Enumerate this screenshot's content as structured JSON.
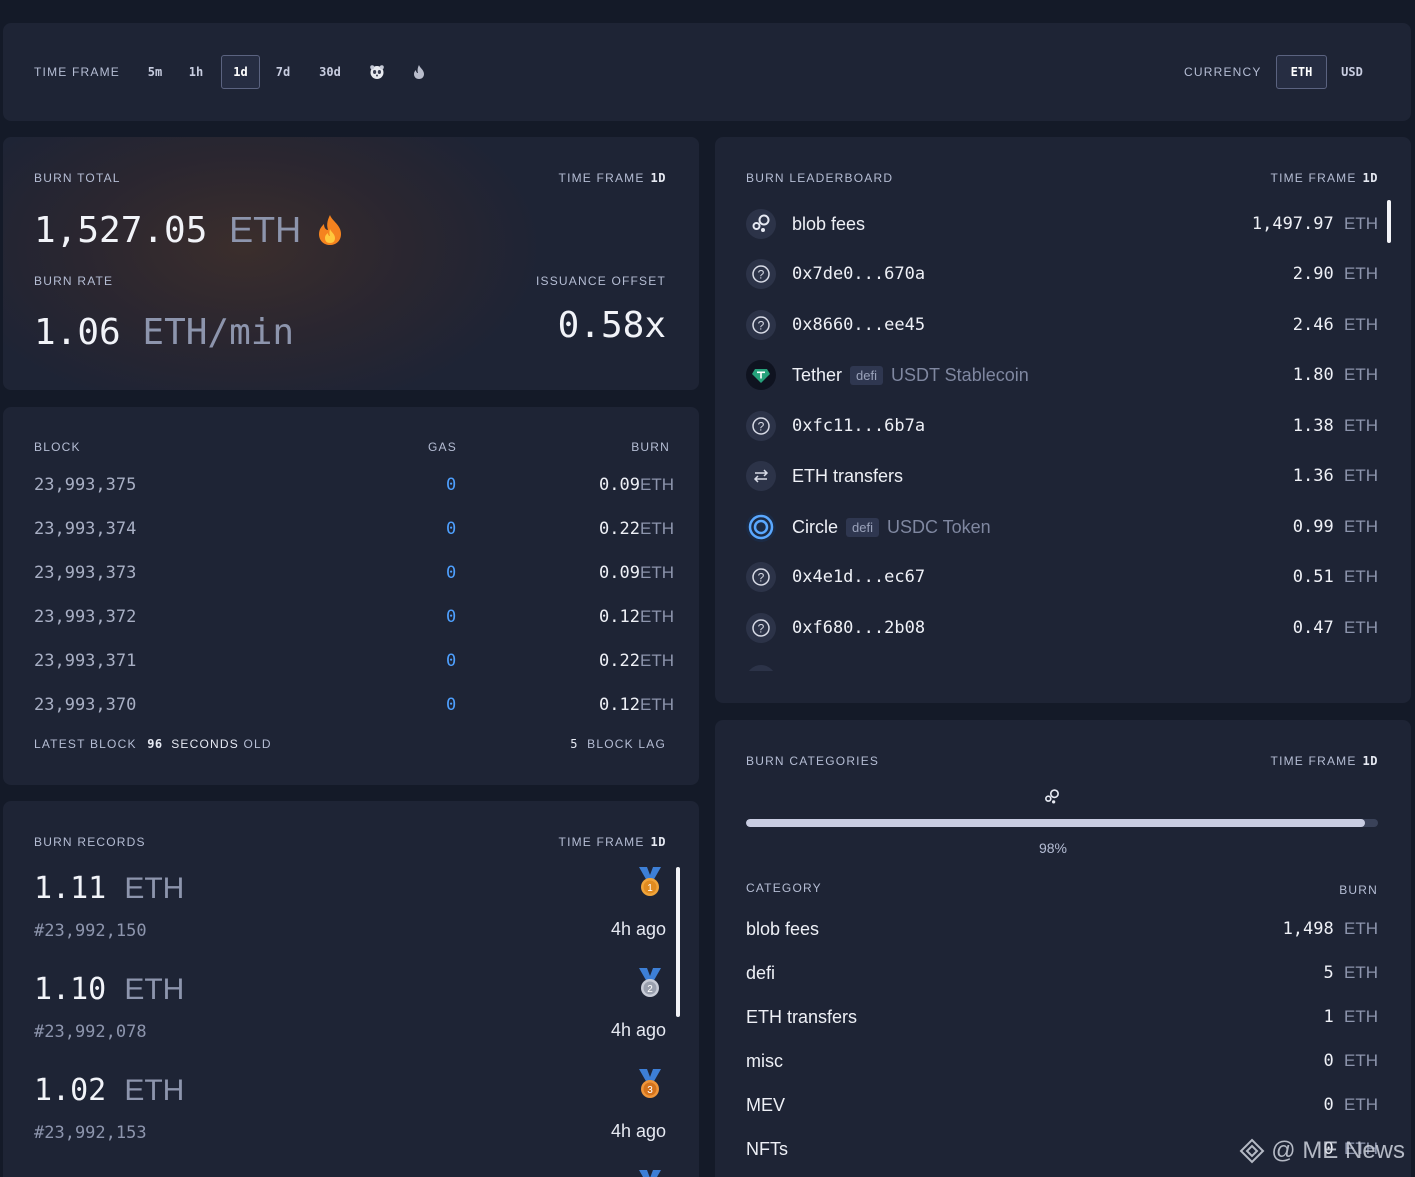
{
  "topbar": {
    "time_frame_label": "TIME FRAME",
    "time_frames": [
      "5m",
      "1h",
      "1d",
      "7d",
      "30d"
    ],
    "active_time_frame": "1d",
    "extra_icons": [
      "panda-icon",
      "fire-icon"
    ],
    "currency_label": "CURRENCY",
    "currencies": [
      "ETH",
      "USD"
    ],
    "active_currency": "ETH"
  },
  "burn_total": {
    "label": "BURN TOTAL",
    "tf_label": "TIME FRAME",
    "tf_value": "1d",
    "value": "1,527.05",
    "unit": "ETH",
    "rate_label": "BURN RATE",
    "rate_value": "1.06",
    "rate_unit": "ETH/min",
    "offset_label": "ISSUANCE OFFSET",
    "offset_value": "0.58x"
  },
  "blocks": {
    "headers": {
      "block": "BLOCK",
      "gas": "GAS",
      "burn": "BURN"
    },
    "rows": [
      {
        "number": "23,993,375",
        "gas": "0",
        "burn": "0.09",
        "unit": "ETH"
      },
      {
        "number": "23,993,374",
        "gas": "0",
        "burn": "0.22",
        "unit": "ETH"
      },
      {
        "number": "23,993,373",
        "gas": "0",
        "burn": "0.09",
        "unit": "ETH"
      },
      {
        "number": "23,993,372",
        "gas": "0",
        "burn": "0.12",
        "unit": "ETH"
      },
      {
        "number": "23,993,371",
        "gas": "0",
        "burn": "0.22",
        "unit": "ETH"
      },
      {
        "number": "23,993,370",
        "gas": "0",
        "burn": "0.12",
        "unit": "ETH"
      }
    ],
    "footer": {
      "latest_prefix": "LATEST BLOCK",
      "latest_value": "96",
      "latest_unit": "SECONDS",
      "latest_suffix": "OLD",
      "lag_value": "5",
      "lag_label": "BLOCK LAG"
    }
  },
  "records": {
    "label": "BURN RECORDS",
    "tf_label": "TIME FRAME",
    "tf_value": "1d",
    "items": [
      {
        "value": "1.11",
        "unit": "ETH",
        "block": "#23,992,150",
        "ago": "4h ago",
        "rank": "1",
        "color": "#f0a43a"
      },
      {
        "value": "1.10",
        "unit": "ETH",
        "block": "#23,992,078",
        "ago": "4h ago",
        "rank": "2",
        "color": "#b8bcc8"
      },
      {
        "value": "1.02",
        "unit": "ETH",
        "block": "#23,992,153",
        "ago": "4h ago",
        "rank": "3",
        "color": "#e8893a"
      }
    ]
  },
  "leaderboard": {
    "label": "BURN LEADERBOARD",
    "tf_label": "TIME FRAME",
    "tf_value": "1d",
    "rows": [
      {
        "icon": "blob-icon",
        "name": "blob fees",
        "mono": false,
        "tag": "",
        "sub": "",
        "amount": "1,497.97",
        "unit": "ETH"
      },
      {
        "icon": "question-icon",
        "name": "0x7de0...670a",
        "mono": true,
        "tag": "",
        "sub": "",
        "amount": "2.90",
        "unit": "ETH"
      },
      {
        "icon": "question-icon",
        "name": "0x8660...ee45",
        "mono": true,
        "tag": "",
        "sub": "",
        "amount": "2.46",
        "unit": "ETH"
      },
      {
        "icon": "tether-icon",
        "name": "Tether",
        "mono": false,
        "tag": "defi",
        "sub": "USDT Stablecoin",
        "amount": "1.80",
        "unit": "ETH"
      },
      {
        "icon": "question-icon",
        "name": "0xfc11...6b7a",
        "mono": true,
        "tag": "",
        "sub": "",
        "amount": "1.38",
        "unit": "ETH"
      },
      {
        "icon": "transfer-icon",
        "name": "ETH transfers",
        "mono": false,
        "tag": "",
        "sub": "",
        "amount": "1.36",
        "unit": "ETH"
      },
      {
        "icon": "circle-icon",
        "name": "Circle",
        "mono": false,
        "tag": "defi",
        "sub": "USDC Token",
        "amount": "0.99",
        "unit": "ETH"
      },
      {
        "icon": "question-icon",
        "name": "0x4e1d...ec67",
        "mono": true,
        "tag": "",
        "sub": "",
        "amount": "0.51",
        "unit": "ETH"
      },
      {
        "icon": "question-icon",
        "name": "0xf680...2b08",
        "mono": true,
        "tag": "",
        "sub": "",
        "amount": "0.47",
        "unit": "ETH"
      }
    ]
  },
  "categories": {
    "label": "BURN CATEGORIES",
    "tf_label": "TIME FRAME",
    "tf_value": "1d",
    "bar_percent_label": "98%",
    "bar_fraction": 0.98,
    "col_category": "CATEGORY",
    "col_burn": "BURN",
    "rows": [
      {
        "name": "blob fees",
        "value": "1,498",
        "unit": "ETH"
      },
      {
        "name": "defi",
        "value": "5",
        "unit": "ETH"
      },
      {
        "name": "ETH transfers",
        "value": "1",
        "unit": "ETH"
      },
      {
        "name": "misc",
        "value": "0",
        "unit": "ETH"
      },
      {
        "name": "MEV",
        "value": "0",
        "unit": "ETH"
      },
      {
        "name": "NFTs",
        "value": "0",
        "unit": "ETH"
      }
    ]
  },
  "watermark": "@ ME News"
}
